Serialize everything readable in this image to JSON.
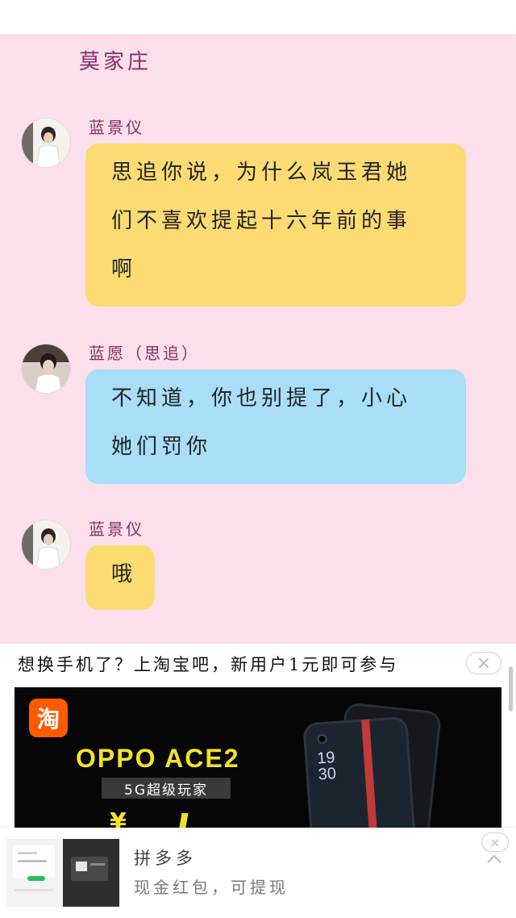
{
  "chat": {
    "title": "莫家庄",
    "messages": [
      {
        "sender": "蓝景仪",
        "lines": [
          "思追你说，为什么岚玉君她",
          "们不喜欢提起十六年前的事",
          "啊"
        ],
        "color": "yellow"
      },
      {
        "sender": "蓝愿（思追）",
        "lines": [
          "不知道，你也别提了，小心",
          "她们罚你"
        ],
        "color": "blue"
      },
      {
        "sender": "蓝景仪",
        "lines": [
          "哦"
        ],
        "color": "yellow"
      }
    ]
  },
  "ad_banner": {
    "text": "想换手机了？上淘宝吧，新用户1元即可参与",
    "close_symbol": "×",
    "logo_text": "淘",
    "product_title": "OPPO ACE2",
    "product_subtitle": "5G超级玩家",
    "price_symbol": "¥",
    "phone_time": [
      "19",
      "30"
    ]
  },
  "bottom_ad": {
    "app_name": "拼多多",
    "description": "现金红包，可提现",
    "close_symbol": "×"
  },
  "colors": {
    "chat_background": "#fbe0ec",
    "name_color": "#8a2a6a",
    "yellow_bubble": "#fcdc72",
    "blue_bubble": "#a8def7",
    "ad_title_yellow": "#f5e227",
    "taobao_orange": "#ff5a00"
  }
}
